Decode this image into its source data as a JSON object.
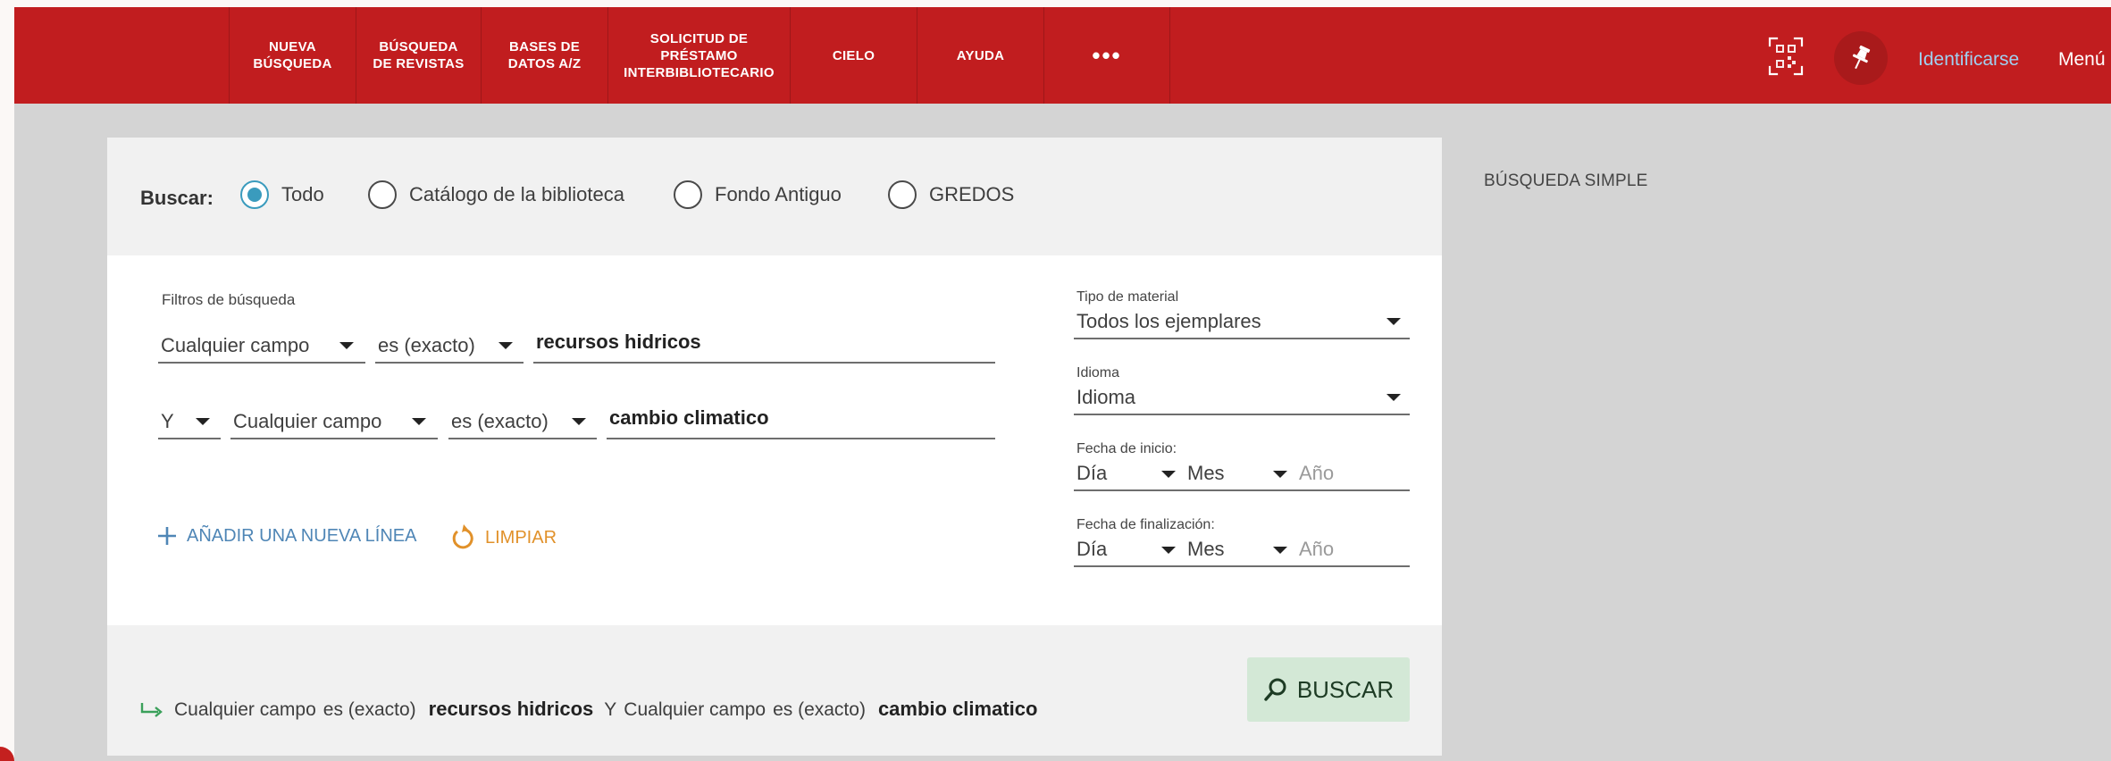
{
  "nav": {
    "items": [
      {
        "lines": [
          "NUEVA",
          "BÚSQUEDA"
        ]
      },
      {
        "lines": [
          "BÚSQUEDA",
          "DE REVISTAS"
        ]
      },
      {
        "lines": [
          "BASES DE",
          "DATOS A/Z"
        ]
      },
      {
        "lines": [
          "SOLICITUD DE",
          "PRÉSTAMO",
          "INTERBIBLIOTECARIO"
        ]
      },
      {
        "lines": [
          "CIELO"
        ]
      },
      {
        "lines": [
          "AYUDA"
        ]
      }
    ],
    "more_label": "•••",
    "login_label": "Identificarse",
    "menu_label": "Menú",
    "icons": {
      "qr": "qr-code-icon",
      "pin": "pin-icon"
    }
  },
  "search": {
    "scope_label": "Buscar:",
    "scopes": [
      {
        "label": "Todo",
        "checked": true
      },
      {
        "label": "Catálogo de la biblioteca",
        "checked": false
      },
      {
        "label": "Fondo Antiguo",
        "checked": false
      },
      {
        "label": "GREDOS",
        "checked": false
      }
    ],
    "filters_title": "Filtros de búsqueda",
    "row1": {
      "field": "Cualquier campo",
      "operator": "es (exacto)",
      "value": "recursos hidricos"
    },
    "row2": {
      "boolean": "Y",
      "field": "Cualquier campo",
      "operator": "es (exacto)",
      "value": "cambio climatico"
    },
    "add_line_label": "AÑADIR UNA NUEVA LÍNEA",
    "clear_label": "LIMPIAR",
    "material": {
      "label": "Tipo de material",
      "value": "Todos los ejemplares"
    },
    "language": {
      "label": "Idioma",
      "value": "Idioma"
    },
    "start_date": {
      "label": "Fecha de inicio:",
      "day": "Día",
      "month": "Mes",
      "year": "Año"
    },
    "end_date": {
      "label": "Fecha de finalización:",
      "day": "Día",
      "month": "Mes",
      "year": "Año"
    },
    "summary": {
      "field1": "Cualquier campo",
      "op1": "es (exacto)",
      "val1": "recursos hidricos",
      "bool": "Y",
      "field2": "Cualquier campo",
      "op2": "es (exacto)",
      "val2": "cambio climatico"
    },
    "search_button_label": "BUSCAR"
  },
  "sidebar": {
    "title": "BÚSQUEDA SIMPLE"
  },
  "colors": {
    "brand_red": "#c11d1f",
    "accent_teal": "#3a9bbd",
    "link_blue": "#4f86b6",
    "clear_orange": "#e1912a",
    "search_green": "#d3e8d6"
  }
}
